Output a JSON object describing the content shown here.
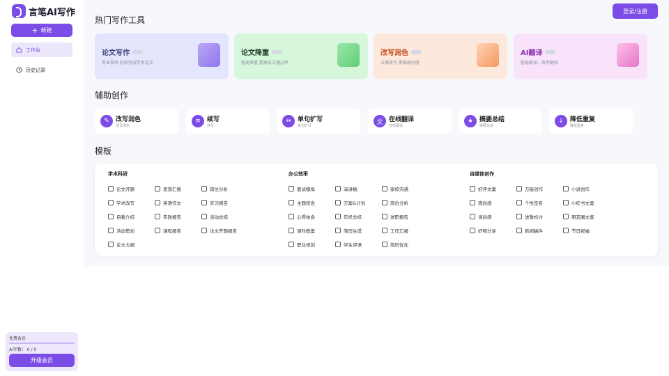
{
  "app": {
    "name": "言笔AI写作"
  },
  "sidebar": {
    "new_label": "新建",
    "items": [
      {
        "label": "工作台",
        "icon": "home-icon",
        "active": true
      },
      {
        "label": "历史记录",
        "icon": "clock-icon",
        "active": false
      }
    ],
    "member": {
      "title": "免费会员",
      "count": "AI字数： 0 / 0",
      "upgrade_label": "升级会员"
    }
  },
  "header": {
    "login_label": "登录/注册"
  },
  "sections": {
    "hot": "热门写作工具",
    "aux": "辅助创作",
    "templates": "模板"
  },
  "hot_tools": [
    {
      "name": "论文写作",
      "desc": "专业指导 轻松完成学术论文"
    },
    {
      "name": "论文降重",
      "desc": "智能降重 提高论文通过率"
    },
    {
      "name": "改写润色",
      "desc": "文案改写 提高原创度"
    },
    {
      "name": "AI翻译",
      "desc": "智能翻译，效率翻倍"
    }
  ],
  "aux_tools": [
    {
      "name": "改写润色",
      "sub": "改写润色"
    },
    {
      "name": "续写",
      "sub": "续写"
    },
    {
      "name": "单句扩写",
      "sub": "单句扩写"
    },
    {
      "name": "在线翻译",
      "sub": "在线翻译"
    },
    {
      "name": "摘要总结",
      "sub": "摘要总结"
    },
    {
      "name": "降低重复",
      "sub": "降低重复"
    }
  ],
  "template_groups": [
    {
      "title": "学术科研",
      "items": [
        "论文开题",
        "思想汇报",
        "岗位分析",
        "学术改写",
        "英语作文",
        "实习报告",
        "自我介绍",
        "实践报告",
        "活动总结",
        "活动策划",
        "课程报告",
        "论文开题报告",
        "论文大纲"
      ]
    },
    {
      "title": "办公效率",
      "items": [
        "面试模拟",
        "演讲稿",
        "家校沟通",
        "主题班会",
        "方案&计划",
        "岗位分析",
        "心得体会",
        "年终总结",
        "述职报告",
        "课时教案",
        "简历生成",
        "工作汇报",
        "职业规划",
        "学生评语",
        "简历优化"
      ]
    },
    {
      "title": "自媒体创作",
      "items": [
        "好评文案",
        "万能创作",
        "小说创作",
        "观后感",
        "个性签名",
        "小红书文案",
        "读后感",
        "进散检讨",
        "朋友圈文案",
        "好物分享",
        "新闻稿件",
        "节日祝福"
      ]
    }
  ],
  "colors": {
    "accent": "#7b4ce6",
    "main_bg": "#f7f8fc"
  }
}
